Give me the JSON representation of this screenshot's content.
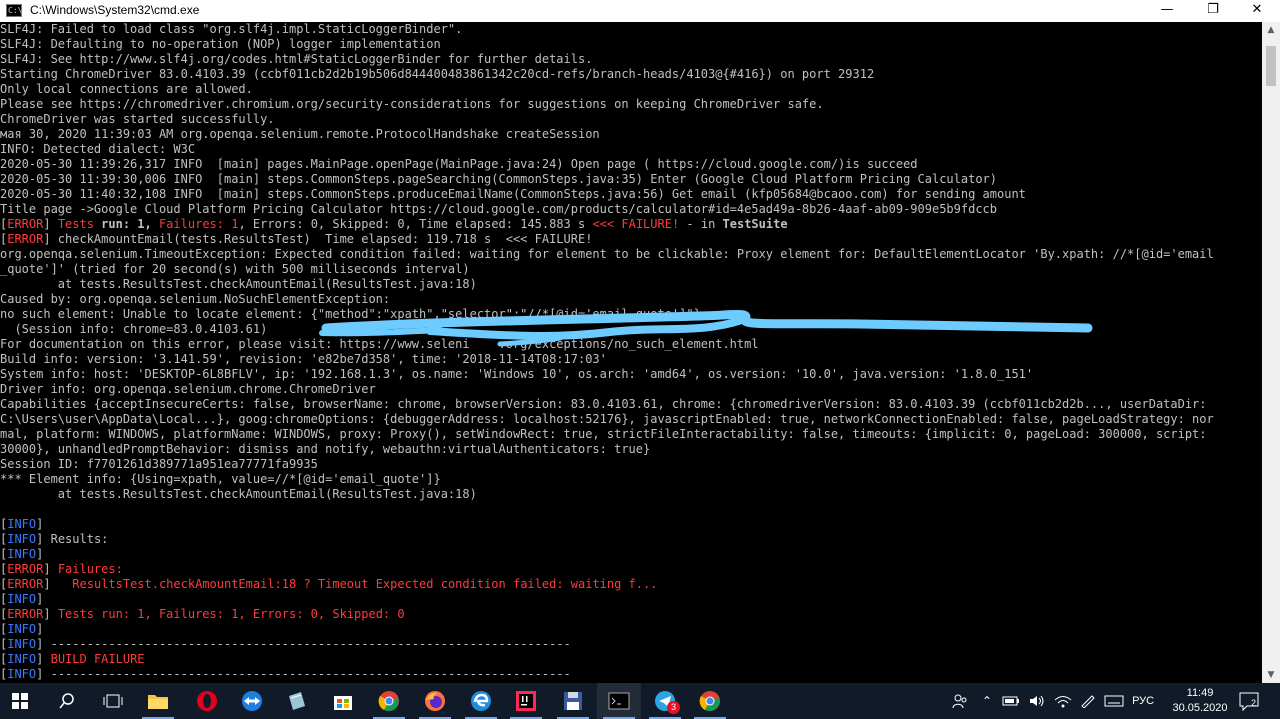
{
  "window": {
    "title": "C:\\Windows\\System32\\cmd.exe",
    "minimize_label": "—",
    "maximize_label": "❐",
    "close_label": "✕"
  },
  "console_lines": [
    [
      {
        "t": "SLF4J: Failed to load class \"org.slf4j.impl.StaticLoggerBinder\"."
      }
    ],
    [
      {
        "t": "SLF4J: Defaulting to no-operation (NOP) logger implementation"
      }
    ],
    [
      {
        "t": "SLF4J: See http://www.slf4j.org/codes.html#StaticLoggerBinder for further details."
      }
    ],
    [
      {
        "t": "Starting ChromeDriver 83.0.4103.39 (ccbf011cb2d2b19b506d844400483861342c20cd-refs/branch-heads/4103@{#416}) on port 29312"
      }
    ],
    [
      {
        "t": "Only local connections are allowed."
      }
    ],
    [
      {
        "t": "Please see https://chromedriver.chromium.org/security-considerations for suggestions on keeping ChromeDriver safe."
      }
    ],
    [
      {
        "t": "ChromeDriver was started successfully."
      }
    ],
    [
      {
        "t": "мая 30, 2020 11:39:03 AM org.openqa.selenium.remote.ProtocolHandshake createSession"
      }
    ],
    [
      {
        "t": "INFO: Detected dialect: W3C"
      }
    ],
    [
      {
        "t": "2020-05-30 11:39:26,317 INFO  [main] pages.MainPage.openPage(MainPage.java:24) Open page ( https://cloud.google.com/)is succeed"
      }
    ],
    [
      {
        "t": "2020-05-30 11:39:30,006 INFO  [main] steps.CommonSteps.pageSearching(CommonSteps.java:35) Enter (Google Cloud Platform Pricing Calculator)"
      }
    ],
    [
      {
        "t": "2020-05-30 11:40:32,108 INFO  [main] steps.CommonSteps.produceEmailName(CommonSteps.java:56) Get email (kfp05684@bcaoo.com) for sending amount"
      }
    ],
    [
      {
        "t": "Title page ->Google Cloud Platform Pricing Calculator https://cloud.google.com/products/calculator#id=4e5ad49a-8b26-4aaf-ab09-909e5b9fdccb"
      }
    ],
    [
      {
        "t": "[",
        "c": ""
      },
      {
        "t": "ERROR",
        "c": "err-tag"
      },
      {
        "t": "] "
      },
      {
        "t": "Tests ",
        "c": "red"
      },
      {
        "t": "run: 1, ",
        "c": "bold"
      },
      {
        "t": "Failures: 1",
        "c": "red"
      },
      {
        "t": ", Errors: 0, Skipped: 0, Time elapsed: 145.883 s "
      },
      {
        "t": "<<< FAILURE!",
        "c": "red"
      },
      {
        "t": " - in "
      },
      {
        "t": "TestSuite",
        "c": "bold"
      }
    ],
    [
      {
        "t": "["
      },
      {
        "t": "ERROR",
        "c": "err-tag"
      },
      {
        "t": "] checkAmountEmail(tests.ResultsTest)  Time elapsed: 119.718 s  <<< FAILURE!"
      }
    ],
    [
      {
        "t": "org.openqa.selenium.TimeoutException: Expected condition failed: waiting for element to be clickable: Proxy element for: DefaultElementLocator 'By.xpath: //*[@id='email"
      }
    ],
    [
      {
        "t": "_quote']' (tried for 20 second(s) with 500 milliseconds interval)"
      }
    ],
    [
      {
        "t": "        at tests.ResultsTest.checkAmountEmail(ResultsTest.java:18)"
      }
    ],
    [
      {
        "t": "Caused by: org.openqa.selenium.NoSuchElementException:"
      }
    ],
    [
      {
        "t": "no such element: Unable to locate element: {\"method\":\"xpath\",\"selector\":\"//*[@id='email_quote']\"}"
      }
    ],
    [
      {
        "t": "  (Session info: chrome=83.0.4103.61)"
      }
    ],
    [
      {
        "t": "For documentation on this error, please visit: https://www.seleni    .org/exceptions/no_such_element.html"
      }
    ],
    [
      {
        "t": "Build info: version: '3.141.59', revision: 'e82be7d358', time: '2018-11-14T08:17:03'"
      }
    ],
    [
      {
        "t": "System info: host: 'DESKTOP-6L8BFLV', ip: '192.168.1.3', os.name: 'Windows 10', os.arch: 'amd64', os.version: '10.0', java.version: '1.8.0_151'"
      }
    ],
    [
      {
        "t": "Driver info: org.openqa.selenium.chrome.ChromeDriver"
      }
    ],
    [
      {
        "t": "Capabilities {acceptInsecureCerts: false, browserName: chrome, browserVersion: 83.0.4103.61, chrome: {chromedriverVersion: 83.0.4103.39 (ccbf011cb2d2b..., userDataDir:"
      }
    ],
    [
      {
        "t": "C:\\Users\\user\\AppData\\Local...}, goog:chromeOptions: {debuggerAddress: localhost:52176}, javascriptEnabled: true, networkConnectionEnabled: false, pageLoadStrategy: nor"
      }
    ],
    [
      {
        "t": "mal, platform: WINDOWS, platformName: WINDOWS, proxy: Proxy(), setWindowRect: true, strictFileInteractability: false, timeouts: {implicit: 0, pageLoad: 300000, script:"
      }
    ],
    [
      {
        "t": "30000}, unhandledPromptBehavior: dismiss and notify, webauthn:virtualAuthenticators: true}"
      }
    ],
    [
      {
        "t": "Session ID: f7701261d389771a951ea77771fa9935"
      }
    ],
    [
      {
        "t": "*** Element info: {Using=xpath, value=//*[@id='email_quote']}"
      }
    ],
    [
      {
        "t": "        at tests.ResultsTest.checkAmountEmail(ResultsTest.java:18)"
      }
    ],
    [
      {
        "t": ""
      }
    ],
    [
      {
        "t": "["
      },
      {
        "t": "INFO",
        "c": "info-tag"
      },
      {
        "t": "]"
      }
    ],
    [
      {
        "t": "["
      },
      {
        "t": "INFO",
        "c": "info-tag"
      },
      {
        "t": "] Results:"
      }
    ],
    [
      {
        "t": "["
      },
      {
        "t": "INFO",
        "c": "info-tag"
      },
      {
        "t": "]"
      }
    ],
    [
      {
        "t": "["
      },
      {
        "t": "ERROR",
        "c": "err-tag"
      },
      {
        "t": "] "
      },
      {
        "t": "Failures:",
        "c": "red"
      }
    ],
    [
      {
        "t": "["
      },
      {
        "t": "ERROR",
        "c": "err-tag"
      },
      {
        "t": "]   "
      },
      {
        "t": "ResultsTest.checkAmountEmail:18 ? Timeout Expected condition failed: waiting f...",
        "c": "red"
      }
    ],
    [
      {
        "t": "["
      },
      {
        "t": "INFO",
        "c": "info-tag"
      },
      {
        "t": "]"
      }
    ],
    [
      {
        "t": "["
      },
      {
        "t": "ERROR",
        "c": "err-tag"
      },
      {
        "t": "] "
      },
      {
        "t": "Tests run: 1, Failures: 1, Errors: 0, Skipped: 0",
        "c": "red"
      }
    ],
    [
      {
        "t": "["
      },
      {
        "t": "INFO",
        "c": "info-tag"
      },
      {
        "t": "]"
      }
    ],
    [
      {
        "t": "["
      },
      {
        "t": "INFO",
        "c": "info-tag"
      },
      {
        "t": "] ------------------------------------------------------------------------"
      }
    ],
    [
      {
        "t": "["
      },
      {
        "t": "INFO",
        "c": "info-tag"
      },
      {
        "t": "] "
      },
      {
        "t": "BUILD FAILURE",
        "c": "red"
      }
    ],
    [
      {
        "t": "["
      },
      {
        "t": "INFO",
        "c": "info-tag"
      },
      {
        "t": "] ------------------------------------------------------------------------"
      }
    ]
  ],
  "taskbar": {
    "apps": [
      {
        "name": "start-button",
        "icon": "windows-icon"
      },
      {
        "name": "search-button",
        "icon": "search-icon"
      },
      {
        "name": "task-view-button",
        "icon": "task-view-icon"
      },
      {
        "name": "file-explorer-button",
        "icon": "folder-icon"
      },
      {
        "name": "opera-button",
        "icon": "opera-icon"
      },
      {
        "name": "teamviewer-button",
        "icon": "teamviewer-icon"
      },
      {
        "name": "notes-button",
        "icon": "notes-icon"
      },
      {
        "name": "store-button",
        "icon": "store-icon"
      },
      {
        "name": "chrome-button",
        "icon": "chrome-icon"
      },
      {
        "name": "firefox-button",
        "icon": "firefox-icon"
      },
      {
        "name": "edge-button",
        "icon": "edge-icon"
      },
      {
        "name": "intellij-button",
        "icon": "intellij-icon"
      },
      {
        "name": "save-app-button",
        "icon": "floppy-icon"
      },
      {
        "name": "cmd-button",
        "icon": "cmd-icon"
      },
      {
        "name": "telegram-button",
        "icon": "telegram-icon",
        "badge": "3"
      },
      {
        "name": "chrome-second-button",
        "icon": "chrome-icon"
      }
    ],
    "language": "РУС",
    "time": "11:49",
    "date": "30.05.2020",
    "notification_count": "2"
  }
}
